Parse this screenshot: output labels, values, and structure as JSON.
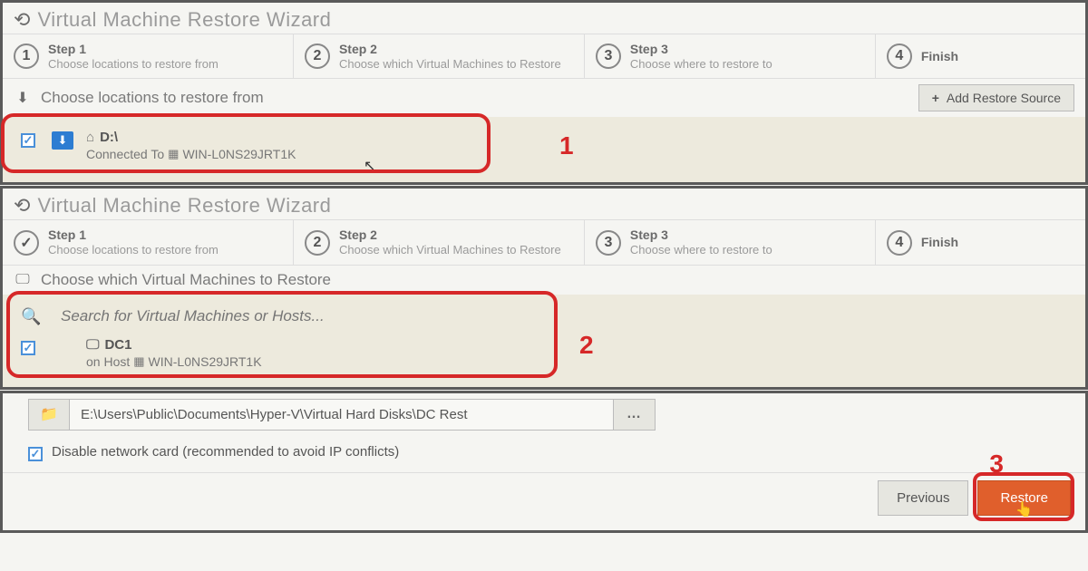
{
  "wizard": {
    "title": "Virtual Machine Restore Wizard",
    "steps": [
      {
        "num": "1",
        "title": "Step 1",
        "sub": "Choose locations to restore from"
      },
      {
        "num": "2",
        "title": "Step 2",
        "sub": "Choose which Virtual Machines to Restore"
      },
      {
        "num": "3",
        "title": "Step 3",
        "sub": "Choose where to restore to"
      },
      {
        "num": "4",
        "title": "Finish",
        "sub": ""
      }
    ]
  },
  "panel1": {
    "subheader": "Choose locations to restore from",
    "add_button": "Add Restore Source",
    "item": {
      "drive": "D:\\",
      "connected_label": "Connected To",
      "host": "WIN-L0NS29JRT1K"
    },
    "annotation": "1"
  },
  "panel2": {
    "subheader": "Choose which Virtual Machines to Restore",
    "search_placeholder": "Search for Virtual Machines or Hosts...",
    "item": {
      "name": "DC1",
      "host_label": "on Host",
      "host": "WIN-L0NS29JRT1K"
    },
    "annotation": "2"
  },
  "panel3": {
    "path": "E:\\Users\\Public\\Documents\\Hyper-V\\Virtual Hard Disks\\DC Rest",
    "browse": "…",
    "disable_label": "Disable network card (recommended to avoid IP conflicts)",
    "previous": "Previous",
    "restore": "Restore",
    "annotation": "3"
  }
}
